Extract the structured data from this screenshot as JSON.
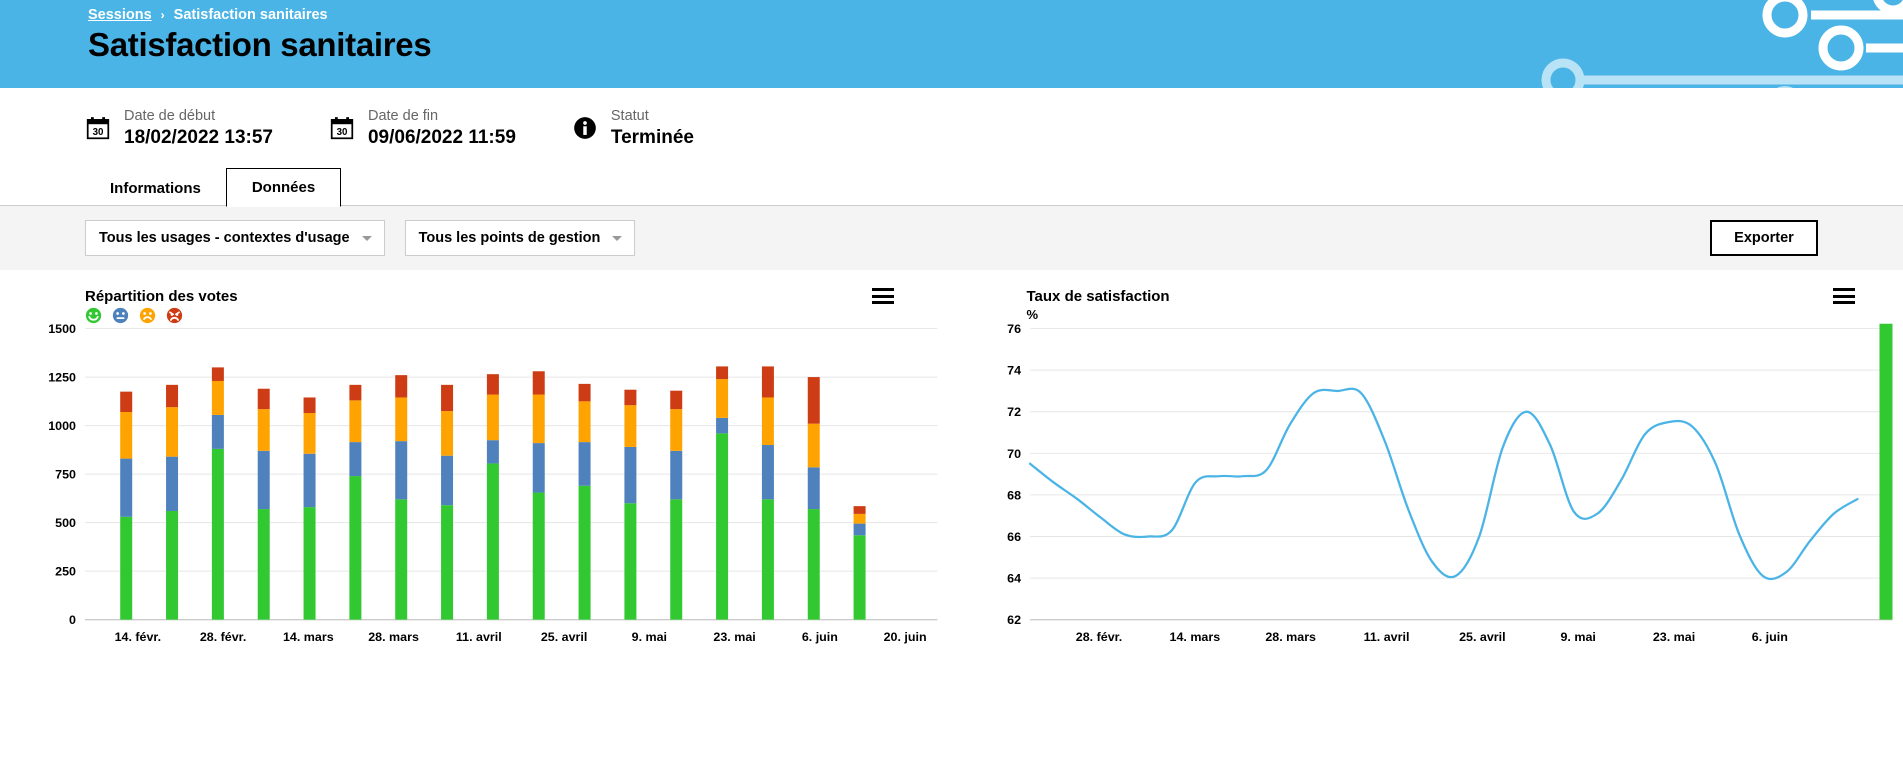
{
  "header": {
    "breadcrumb": {
      "parent": "Sessions",
      "separator": "›",
      "current": "Satisfaction sanitaires"
    },
    "title": "Satisfaction sanitaires",
    "background_color": "#4bb4e6"
  },
  "meta": {
    "items": [
      {
        "icon": "calendar-icon",
        "label": "Date de début",
        "value": "18/02/2022 13:57"
      },
      {
        "icon": "calendar-icon",
        "label": "Date de fin",
        "value": "09/06/2022 11:59"
      },
      {
        "icon": "info-icon",
        "label": "Statut",
        "value": "Terminée"
      }
    ]
  },
  "tabs": [
    {
      "label": "Informations",
      "active": false
    },
    {
      "label": "Données",
      "active": true
    }
  ],
  "toolbar": {
    "usage_filter": {
      "value": "Tous les usages - contextes d'usage"
    },
    "location_filter": {
      "value": "Tous les points de gestion"
    },
    "export_label": "Exporter"
  },
  "chart_data": [
    {
      "type": "bar",
      "title": "Répartition des votes",
      "stacked": true,
      "menu_icon": "hamburger-menu-icon",
      "xlabel": "",
      "ylabel": "",
      "ylim": [
        0,
        1500
      ],
      "yticks": [
        0,
        250,
        500,
        750,
        1000,
        1250,
        1500
      ],
      "grid": true,
      "legend_position": "top-left",
      "legend": [
        {
          "name": "Très satisfait",
          "icon": "smiley-happy-icon",
          "color": "#32c832"
        },
        {
          "name": "Satisfait",
          "icon": "smiley-neutral-icon",
          "color": "#4f81bd"
        },
        {
          "name": "Peu satisfait",
          "icon": "smiley-unhappy-icon",
          "color": "#ffa300"
        },
        {
          "name": "Pas satisfait",
          "icon": "smiley-angry-icon",
          "color": "#cd3c14"
        }
      ],
      "categories": [
        "14. févr.",
        "28. févr.",
        "14. mars",
        "28. mars",
        "11. avril",
        "25. avril",
        "9. mai",
        "23. mai",
        "6. juin",
        "20. juin"
      ],
      "xticks": [
        "14. févr.",
        "28. févr.",
        "14. mars",
        "28. mars",
        "11. avril",
        "25. avril",
        "9. mai",
        "23. mai",
        "6. juin",
        "20. juin"
      ],
      "series": [
        {
          "name": "Très satisfait",
          "color": "#32c832",
          "values": [
            530,
            560,
            880,
            570,
            580,
            740,
            620,
            590,
            805,
            655,
            690,
            600,
            620,
            960,
            620,
            570,
            435
          ]
        },
        {
          "name": "Satisfait",
          "color": "#4f81bd",
          "values": [
            300,
            280,
            175,
            300,
            275,
            175,
            300,
            255,
            120,
            255,
            225,
            290,
            250,
            80,
            280,
            215,
            60
          ]
        },
        {
          "name": "Peu satisfait",
          "color": "#ffa300",
          "values": [
            240,
            255,
            175,
            215,
            210,
            215,
            225,
            230,
            235,
            250,
            210,
            215,
            215,
            200,
            245,
            225,
            50
          ]
        },
        {
          "name": "Pas satisfait",
          "color": "#cd3c14",
          "values": [
            105,
            115,
            70,
            105,
            80,
            80,
            115,
            135,
            105,
            120,
            90,
            80,
            95,
            65,
            160,
            240,
            40
          ]
        }
      ]
    },
    {
      "type": "line",
      "title": "Taux de satisfaction",
      "menu_icon": "hamburger-menu-icon",
      "unit_label": "%",
      "xlabel": "",
      "ylabel": "%",
      "ylim": [
        62,
        76
      ],
      "yticks": [
        62,
        64,
        66,
        68,
        70,
        72,
        74,
        76
      ],
      "grid": true,
      "line_color": "#4bb4e6",
      "xticks": [
        "28. févr.",
        "14. mars",
        "28. mars",
        "11. avril",
        "25. avril",
        "9. mai",
        "23. mai",
        "6. juin"
      ],
      "series": [
        {
          "name": "Taux de satisfaction",
          "color": "#4bb4e6",
          "values": [
            69.5,
            68.6,
            67.8,
            66.9,
            66.1,
            66.0,
            66.3,
            68.6,
            68.9,
            68.9,
            69.2,
            71.4,
            72.9,
            73.0,
            72.9,
            70.6,
            67.3,
            64.8,
            64.1,
            66.0,
            70.3,
            72.0,
            70.4,
            67.2,
            67.1,
            68.7,
            70.9,
            71.5,
            71.3,
            69.5,
            66.1,
            64.1,
            64.3,
            65.8,
            67.1,
            67.8
          ]
        }
      ],
      "marker": {
        "name": "final-bar-marker",
        "color": "#32c832",
        "value": 76
      }
    }
  ]
}
